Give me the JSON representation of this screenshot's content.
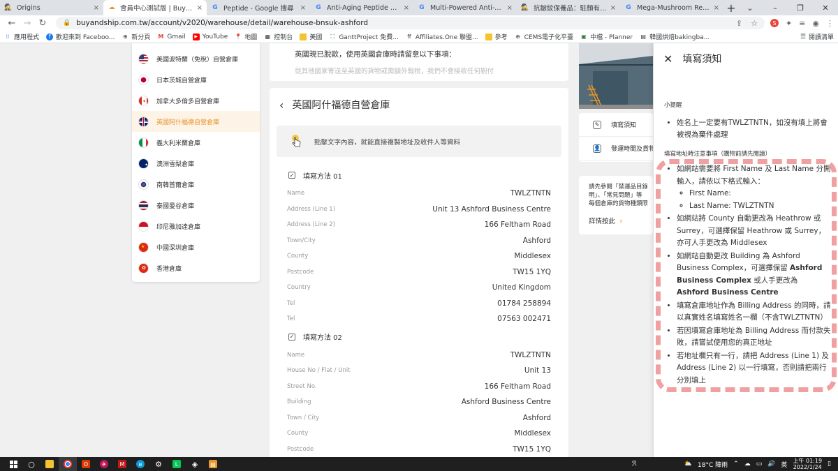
{
  "browser": {
    "tabs": [
      {
        "title": "Origins",
        "active": false
      },
      {
        "title": "會員中心測試版 | Buyandship",
        "active": true
      },
      {
        "title": "Peptide - Google 搜尋",
        "active": false
      },
      {
        "title": "Anti-Aging Peptide Serum - Gr",
        "active": false
      },
      {
        "title": "Multi-Powered Anti-Aging Pep",
        "active": false
      },
      {
        "title": "抗皺紋保養品：駐顏有術全攻略",
        "active": false
      },
      {
        "title": "Mega-Mushroom Relief & Res",
        "active": false
      }
    ],
    "url": "buyandship.com.tw/account/v2020/warehouse/detail/warehouse-bnsuk-ashford",
    "bookmarks": [
      "應用程式",
      "歡迎來到 Faceboo...",
      "新分頁",
      "Gmail",
      "YouTube",
      "地圖",
      "控制台",
      "美國",
      "GanttProject 免費...",
      "Affiliates.One 聯盟...",
      "參考",
      "CEMS電子化平臺",
      "中檔 - Planner",
      "韓國烘焙bakingba..."
    ],
    "reading_list": "閱讀清單"
  },
  "sidebar": {
    "items": [
      {
        "label": "美國波特蘭（免稅）自營倉庫",
        "flag": "us",
        "active": false
      },
      {
        "label": "日本茨城自營倉庫",
        "flag": "jp",
        "active": false
      },
      {
        "label": "加拿大多倫多自營倉庫",
        "flag": "ca",
        "active": false
      },
      {
        "label": "英國阿什福德自營倉庫",
        "flag": "uk",
        "active": true
      },
      {
        "label": "義大利米蘭倉庫",
        "flag": "it",
        "active": false
      },
      {
        "label": "澳洲雪梨倉庫",
        "flag": "au",
        "active": false
      },
      {
        "label": "南韓首爾倉庫",
        "flag": "kr",
        "active": false
      },
      {
        "label": "泰國曼谷倉庫",
        "flag": "th",
        "active": false
      },
      {
        "label": "印尼雅加達倉庫",
        "flag": "id",
        "active": false
      },
      {
        "label": "中國深圳倉庫",
        "flag": "cn",
        "active": false
      },
      {
        "label": "香港倉庫",
        "flag": "hk",
        "active": false
      }
    ]
  },
  "notice": {
    "line1": "英國現已脫歐，使用英國倉庫時請留意以下事項：",
    "line2": "從其他國家寄送至英國的貨物或需額外報稅，我們不會接收任何剔付"
  },
  "main": {
    "title": "英國阿什福德自營倉庫",
    "tip": "點擊文字內容，就能直接複製地址及收件人等資料",
    "method1": {
      "heading": "填寫方法 01",
      "rows": [
        {
          "key": "Name",
          "value": "TWLZTNTN"
        },
        {
          "key": "Address (Line 1)",
          "value": "Unit 13 Ashford Business Centre"
        },
        {
          "key": "Address (Line 2)",
          "value": "166 Feltham Road"
        },
        {
          "key": "Town/City",
          "value": "Ashford"
        },
        {
          "key": "County",
          "value": "Middlesex"
        },
        {
          "key": "Postcode",
          "value": "TW15 1YQ"
        },
        {
          "key": "Country",
          "value": "United Kingdom"
        },
        {
          "key": "Tel",
          "value": "01784 258894"
        },
        {
          "key": "Tel",
          "value": "07563 002471"
        }
      ]
    },
    "method2": {
      "heading": "填寫方法 02",
      "rows": [
        {
          "key": "Name",
          "value": "TWLZTNTN"
        },
        {
          "key": "House No / Flat / Unit",
          "value": "Unit 13"
        },
        {
          "key": "Street No.",
          "value": "166 Feltham Road"
        },
        {
          "key": "Building",
          "value": "Ashford Business Centre"
        },
        {
          "key": "Town / City",
          "value": "Ashford"
        },
        {
          "key": "County",
          "value": "Middlesex"
        },
        {
          "key": "Postcode",
          "value": "TW15 1YQ"
        }
      ]
    }
  },
  "side_cards": {
    "fill_notice": "填寫須知",
    "ship_time": "發運時間及貨物",
    "info_line1": "請先參閱「禁運品目錄",
    "info_line2": "明」、「常見問題」等",
    "info_line3": "每個倉庫的貨物種類限制",
    "more": "詳情按此"
  },
  "panel": {
    "title": "填寫須知",
    "reminder": "小提醒",
    "bullet1": "姓名上一定要有TWLZTNTN，如沒有填上將會被視為棄件處理",
    "subheading": "填寫地址時注意事項（購物前請先閱讀）",
    "b2_intro": "如網站需要將 First Name 及 Last Name 分開輸入，請依以下格式輸入：",
    "b2_first": "First Name:",
    "b2_last": "Last Name: TWLZTNTN",
    "b3": "如網站將 County 自動更改為 Heathrow 或 Surrey，可選擇保留 Heathrow 或 Surrey，亦可人手更改為 Middlesex",
    "b4_pre": "如網站自動更改 Building 為 Ashford Business Complex，可選擇保留",
    "b4_bold1": "Ashford Business Complex",
    "b4_mid": "或人手更改為",
    "b4_bold2": "Ashford Business Centre",
    "b5": "填寫倉庫地址作為 Billing Address 的同時，請以真實姓名填寫姓名一欄（不含TWLZTNTN）",
    "b6": "若因填寫倉庫地址為 Billing Address 而付款失敗，請嘗試使用您的真正地址",
    "b7": "若地址欄只有一行，請把 Address (Line 1) 及 Address (Line 2) 以一行填寫，否則請把兩行分別填上"
  },
  "taskbar": {
    "weather": "18°C 陣雨",
    "ime": "英",
    "time": "上午 01:19",
    "date": "2022/1/24"
  }
}
